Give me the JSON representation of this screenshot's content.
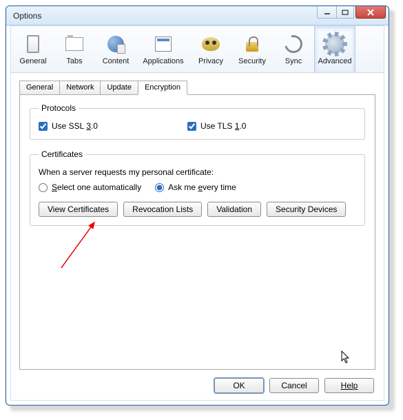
{
  "window": {
    "title": "Options"
  },
  "categories": {
    "general": "General",
    "tabs": "Tabs",
    "content": "Content",
    "applications": "Applications",
    "privacy": "Privacy",
    "security": "Security",
    "sync": "Sync",
    "advanced": "Advanced"
  },
  "sub_tabs": {
    "general": "General",
    "network": "Network",
    "update": "Update",
    "encryption": "Encryption"
  },
  "protocols": {
    "legend": "Protocols",
    "ssl_prefix": "Use SSL ",
    "ssl_key": "3",
    "ssl_suffix": ".0",
    "tls_prefix": "Use TLS ",
    "tls_key": "1",
    "tls_suffix": ".0"
  },
  "certificates": {
    "legend": "Certificates",
    "prompt": "When a server requests my personal certificate:",
    "auto_prefix": "",
    "auto_key": "S",
    "auto_suffix": "elect one automatically",
    "ask_prefix": "Ask me ",
    "ask_key": "e",
    "ask_suffix": "very time",
    "btn_view": "View Certificates",
    "btn_revocation": "Revocation Lists",
    "btn_validation": "Validation",
    "btn_devices": "Security Devices"
  },
  "footer": {
    "ok": "OK",
    "cancel": "Cancel",
    "help": "Help"
  }
}
